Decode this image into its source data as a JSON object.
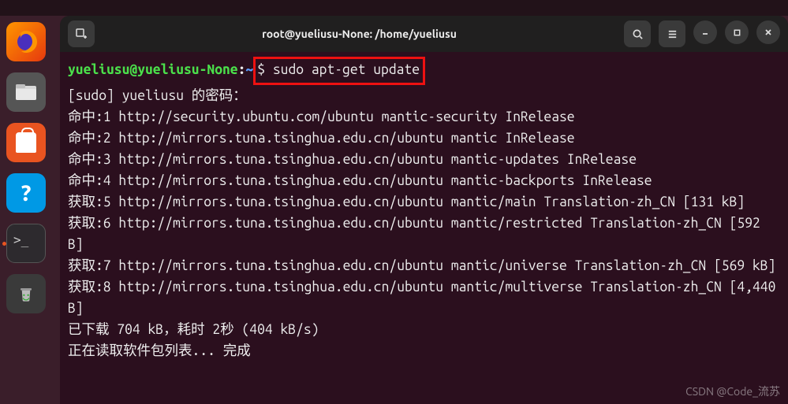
{
  "top_bar": {
    "clock": ""
  },
  "dock": {
    "firefox": "firefox",
    "files": "files",
    "software": "ubuntu-software",
    "help": "?",
    "terminal": "terminal",
    "trash": "trash"
  },
  "window": {
    "title": "root@yueliusu-None: /home/yueliusu"
  },
  "prompt": {
    "user_host": "yueliusu@yueliusu-None",
    "sep1": ":",
    "path": "~",
    "sigil": "$ ",
    "command": "sudo apt-get update"
  },
  "output": {
    "l1": "[sudo] yueliusu 的密码：",
    "l2": "命中:1 http://security.ubuntu.com/ubuntu mantic-security InRelease",
    "l3": "命中:2 http://mirrors.tuna.tsinghua.edu.cn/ubuntu mantic InRelease",
    "l4": "命中:3 http://mirrors.tuna.tsinghua.edu.cn/ubuntu mantic-updates InRelease",
    "l5": "命中:4 http://mirrors.tuna.tsinghua.edu.cn/ubuntu mantic-backports InRelease",
    "l6": "获取:5 http://mirrors.tuna.tsinghua.edu.cn/ubuntu mantic/main Translation-zh_CN [131 kB]",
    "l7": "获取:6 http://mirrors.tuna.tsinghua.edu.cn/ubuntu mantic/restricted Translation-zh_CN [592 B]",
    "l8": "获取:7 http://mirrors.tuna.tsinghua.edu.cn/ubuntu mantic/universe Translation-zh_CN [569 kB]",
    "l9": "获取:8 http://mirrors.tuna.tsinghua.edu.cn/ubuntu mantic/multiverse Translation-zh_CN [4,440 B]",
    "l10": "已下载 704 kB，耗时 2秒 (404 kB/s)",
    "l11": "正在读取软件包列表... 完成"
  },
  "watermark": "CSDN @Code_流苏"
}
